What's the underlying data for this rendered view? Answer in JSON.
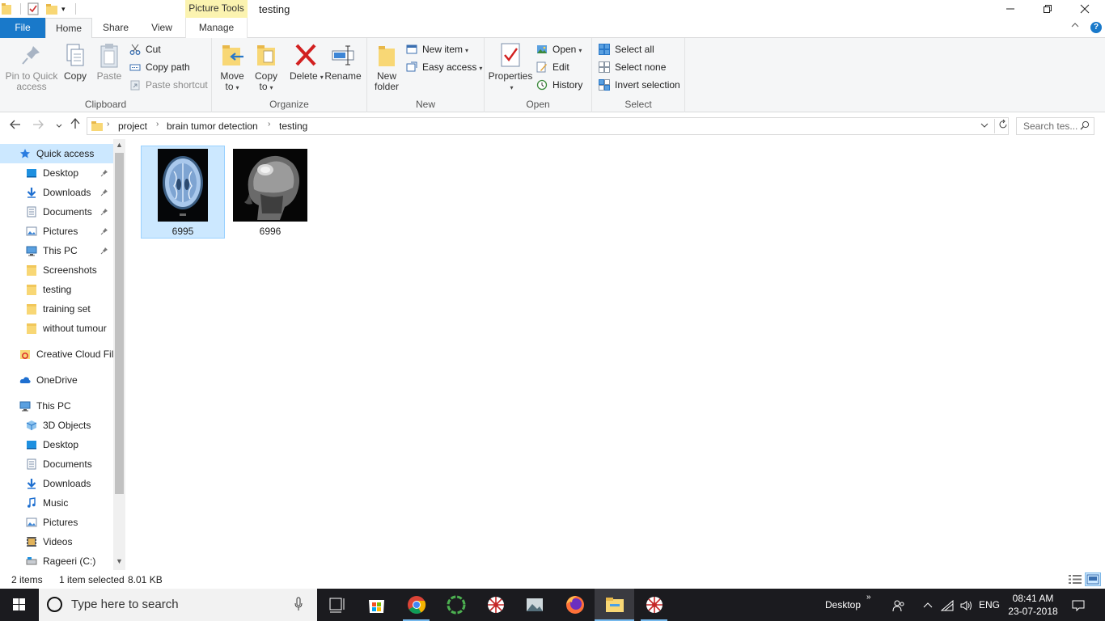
{
  "titlebar": {
    "context_tab_title": "Picture Tools",
    "window_title": "testing",
    "qat_dropdown_glyph": "▾"
  },
  "ribbon_tabs": {
    "file": "File",
    "home": "Home",
    "share": "Share",
    "view": "View",
    "manage": "Manage"
  },
  "clipboard": {
    "label": "Clipboard",
    "pin": "Pin to Quick access",
    "copy": "Copy",
    "paste": "Paste",
    "cut": "Cut",
    "copy_path": "Copy path",
    "paste_shortcut": "Paste shortcut"
  },
  "organize": {
    "label": "Organize",
    "move_to": "Move to",
    "copy_to": "Copy to",
    "delete": "Delete",
    "rename": "Rename"
  },
  "new_group": {
    "label": "New",
    "new_folder": "New folder",
    "new_item": "New item",
    "easy_access": "Easy access"
  },
  "open_group": {
    "label": "Open",
    "properties": "Properties",
    "open": "Open",
    "edit": "Edit",
    "history": "History"
  },
  "select_group": {
    "label": "Select",
    "select_all": "Select all",
    "select_none": "Select none",
    "invert": "Invert selection"
  },
  "address": {
    "crumbs": [
      "project",
      "brain tumor detection",
      "testing"
    ],
    "search_placeholder": "Search tes..."
  },
  "nav": {
    "items": [
      {
        "label": "Quick access",
        "icon": "star-icon",
        "pinned": false
      },
      {
        "label": "Desktop",
        "icon": "desktop-icon",
        "pinned": true
      },
      {
        "label": "Downloads",
        "icon": "download-icon",
        "pinned": true
      },
      {
        "label": "Documents",
        "icon": "documents-icon",
        "pinned": true
      },
      {
        "label": "Pictures",
        "icon": "pictures-icon",
        "pinned": true
      },
      {
        "label": "This PC",
        "icon": "computer-icon",
        "pinned": true
      },
      {
        "label": "Screenshots",
        "icon": "folder-icon",
        "pinned": false
      },
      {
        "label": "testing",
        "icon": "folder-icon",
        "pinned": false
      },
      {
        "label": "training set",
        "icon": "folder-icon",
        "pinned": false
      },
      {
        "label": "without tumour",
        "icon": "folder-icon",
        "pinned": false
      },
      {
        "label": "Creative Cloud Fil",
        "icon": "creative-cloud-icon",
        "pinned": false
      },
      {
        "label": "OneDrive",
        "icon": "cloud-icon",
        "pinned": false
      },
      {
        "label": "This PC",
        "icon": "computer-icon",
        "pinned": false
      },
      {
        "label": "3D Objects",
        "icon": "cube-icon",
        "pinned": false
      },
      {
        "label": "Desktop",
        "icon": "desktop-icon",
        "pinned": false
      },
      {
        "label": "Documents",
        "icon": "documents-icon",
        "pinned": false
      },
      {
        "label": "Downloads",
        "icon": "download-icon",
        "pinned": false
      },
      {
        "label": "Music",
        "icon": "music-icon",
        "pinned": false
      },
      {
        "label": "Pictures",
        "icon": "pictures-icon",
        "pinned": false
      },
      {
        "label": "Videos",
        "icon": "videos-icon",
        "pinned": false
      },
      {
        "label": "Rageeri (C:)",
        "icon": "drive-icon",
        "pinned": false
      }
    ]
  },
  "files": [
    {
      "name": "6995",
      "selected": true
    },
    {
      "name": "6996",
      "selected": false
    }
  ],
  "status": {
    "count": "2 items",
    "selection": "1 item selected",
    "size": "8.01 KB"
  },
  "taskbar": {
    "search_placeholder": "Type here to search",
    "desktop_label": "Desktop",
    "language": "ENG",
    "time": "08:41 AM",
    "date": "23-07-2018"
  },
  "colors": {
    "accent": "#1979ca",
    "selection": "#cce8ff",
    "context_tab": "#fbf3b0",
    "taskbar": "#1b1b1f"
  }
}
